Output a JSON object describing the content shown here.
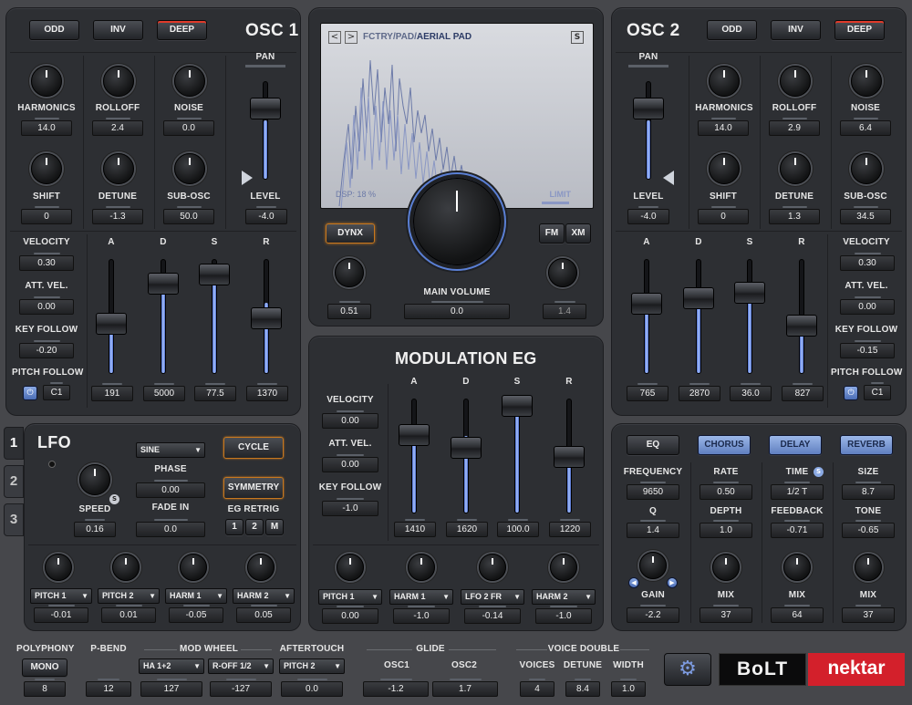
{
  "osc1": {
    "title": "OSC 1",
    "btn_odd": "ODD",
    "btn_inv": "INV",
    "btn_deep": "DEEP",
    "pan": "PAN",
    "level": "LEVEL",
    "level_val": "-4.0",
    "harmonics": "HARMONICS",
    "harmonics_val": "14.0",
    "rolloff": "ROLLOFF",
    "rolloff_val": "2.4",
    "noise": "NOISE",
    "noise_val": "0.0",
    "shift": "SHIFT",
    "shift_val": "0",
    "detune": "DETUNE",
    "detune_val": "-1.3",
    "subosc": "SUB-OSC",
    "subosc_val": "50.0",
    "velocity": "VELOCITY",
    "velocity_val": "0.30",
    "attvel": "ATT. VEL.",
    "attvel_val": "0.00",
    "keyfollow": "KEY FOLLOW",
    "keyfollow_val": "-0.20",
    "pitchfollow": "PITCH FOLLOW",
    "pitchfollow_val": "C1",
    "a": "A",
    "d": "D",
    "s": "S",
    "r": "R",
    "a_val": "191",
    "d_val": "5000",
    "s_val": "77.5",
    "r_val": "1370"
  },
  "osc2": {
    "title": "OSC 2",
    "btn_odd": "ODD",
    "btn_inv": "INV",
    "btn_deep": "DEEP",
    "pan": "PAN",
    "level": "LEVEL",
    "level_val": "-4.0",
    "harmonics": "HARMONICS",
    "harmonics_val": "14.0",
    "rolloff": "ROLLOFF",
    "rolloff_val": "2.9",
    "noise": "NOISE",
    "noise_val": "6.4",
    "shift": "SHIFT",
    "shift_val": "0",
    "detune": "DETUNE",
    "detune_val": "1.3",
    "subosc": "SUB-OSC",
    "subosc_val": "34.5",
    "velocity": "VELOCITY",
    "velocity_val": "0.30",
    "attvel": "ATT. VEL.",
    "attvel_val": "0.00",
    "keyfollow": "KEY FOLLOW",
    "keyfollow_val": "-0.15",
    "pitchfollow": "PITCH FOLLOW",
    "pitchfollow_val": "C1",
    "a": "A",
    "d": "D",
    "s": "S",
    "r": "R",
    "a_val": "765",
    "d_val": "2870",
    "s_val": "36.0",
    "r_val": "827"
  },
  "display": {
    "prev": "<",
    "next": ">",
    "patch_path": "FCTRY/PAD/",
    "patch_name": "AERIAL PAD",
    "s_btn": "S",
    "dsp": "DSP: 18 %",
    "limit": "LIMIT"
  },
  "master": {
    "dynx": "DYNX",
    "fm": "FM",
    "xm": "XM",
    "main_volume": "MAIN VOLUME",
    "main_volume_val": "0.0",
    "left_val": "0.51",
    "right_val": "1.4"
  },
  "modeg": {
    "title": "MODULATION EG",
    "velocity": "VELOCITY",
    "velocity_val": "0.00",
    "attvel": "ATT. VEL.",
    "attvel_val": "0.00",
    "keyfollow": "KEY FOLLOW",
    "keyfollow_val": "-1.0",
    "a": "A",
    "d": "D",
    "s": "S",
    "r": "R",
    "a_val": "1410",
    "d_val": "1620",
    "s_val": "100.0",
    "r_val": "1220",
    "dest": [
      {
        "name": "PITCH 1",
        "val": "0.00"
      },
      {
        "name": "HARM 1",
        "val": "-1.0"
      },
      {
        "name": "LFO 2 FR",
        "val": "-0.14"
      },
      {
        "name": "HARM 2",
        "val": "-1.0"
      }
    ]
  },
  "lfo": {
    "title": "LFO",
    "tabs": [
      "1",
      "2",
      "3"
    ],
    "shape": "SINE",
    "cycle": "CYCLE",
    "symmetry": "SYMMETRY",
    "phase": "PHASE",
    "phase_val": "0.00",
    "fadein": "FADE IN",
    "fadein_val": "0.0",
    "speed": "SPEED",
    "speed_val": "0.16",
    "s_badge": "S",
    "egretrig": "EG RETRIG",
    "retrig_opts": [
      "1",
      "2",
      "M"
    ],
    "dest": [
      {
        "name": "PITCH 1",
        "val": "-0.01"
      },
      {
        "name": "PITCH 2",
        "val": "0.01"
      },
      {
        "name": "HARM 1",
        "val": "-0.05"
      },
      {
        "name": "HARM 2",
        "val": "0.05"
      }
    ]
  },
  "fx": {
    "eq": "EQ",
    "chorus": "CHORUS",
    "delay": "DELAY",
    "reverb": "REVERB",
    "frequency": "FREQUENCY",
    "frequency_val": "9650",
    "q": "Q",
    "q_val": "1.4",
    "gain": "GAIN",
    "gain_val": "-2.2",
    "rate": "RATE",
    "rate_val": "0.50",
    "depth": "DEPTH",
    "depth_val": "1.0",
    "chorus_mix": "MIX",
    "chorus_mix_val": "37",
    "time": "TIME",
    "time_val": "1/2 T",
    "feedback": "FEEDBACK",
    "feedback_val": "-0.71",
    "delay_mix": "MIX",
    "delay_mix_val": "64",
    "size": "SIZE",
    "size_val": "8.7",
    "tone": "TONE",
    "tone_val": "-0.65",
    "reverb_mix": "MIX",
    "reverb_mix_val": "37"
  },
  "bottom": {
    "polyphony": "POLYPHONY",
    "mono": "MONO",
    "poly_val": "8",
    "pbend": "P-BEND",
    "pbend_val": "12",
    "modwheel": "MOD WHEEL",
    "mw1": "HA 1+2",
    "mw1_val": "127",
    "mw2": "R-OFF 1/2",
    "mw2_val": "-127",
    "aftertouch": "AFTERTOUCH",
    "at": "PITCH 2",
    "at_val": "0.0",
    "glide": "GLIDE",
    "osc1": "OSC1",
    "osc1_val": "-1.2",
    "osc2": "OSC2",
    "osc2_val": "1.7",
    "voicedouble": "VOICE DOUBLE",
    "voices": "VOICES",
    "voices_val": "4",
    "detune": "DETUNE",
    "detune_val": "8.4",
    "width": "WIDTH",
    "width_val": "1.0",
    "brand_bolt": "BoLT",
    "brand_nektar": "nektar"
  },
  "colors": {
    "accent_blue": "#8aa9e3",
    "deep_red": "#e03a2a",
    "dynx_orange": "#c8781e",
    "nektar_red": "#d3202b"
  }
}
